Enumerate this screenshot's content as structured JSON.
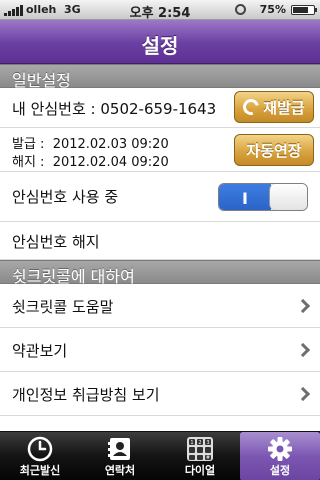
{
  "status_bar": {
    "carrier": "olleh",
    "network": "3G",
    "time": "오후 2:54",
    "battery_pct": "75%",
    "battery_level": 0.75
  },
  "nav": {
    "title": "설정"
  },
  "sections": {
    "general": "일반설정",
    "about": "쉿크릿콜에 대하여"
  },
  "number_row": {
    "label": "내 안심번호 : 0502-659-1643",
    "reissue_button": "재발급"
  },
  "dates_row": {
    "issued": "발급 :  2012.02.03 09:20",
    "expires": "해지 :  2012.02.04 09:20",
    "extend_button": "자동연장"
  },
  "toggle_row": {
    "label": "안심번호 사용 중",
    "toggle_on_text": "I",
    "toggle_state": true
  },
  "cancel_row": {
    "label": "안심번호 해지"
  },
  "menu": [
    {
      "label": "쉿크릿콜 도움말"
    },
    {
      "label": "약관보기"
    },
    {
      "label": "개인정보 취급방침 보기"
    }
  ],
  "tabs": [
    {
      "label": "최근발신",
      "icon": "clock-icon"
    },
    {
      "label": "연락처",
      "icon": "contacts-icon"
    },
    {
      "label": "다이얼",
      "icon": "keypad-icon",
      "keys": [
        "1",
        "2",
        "3",
        "#"
      ]
    },
    {
      "label": "설정",
      "icon": "gear-icon"
    }
  ]
}
